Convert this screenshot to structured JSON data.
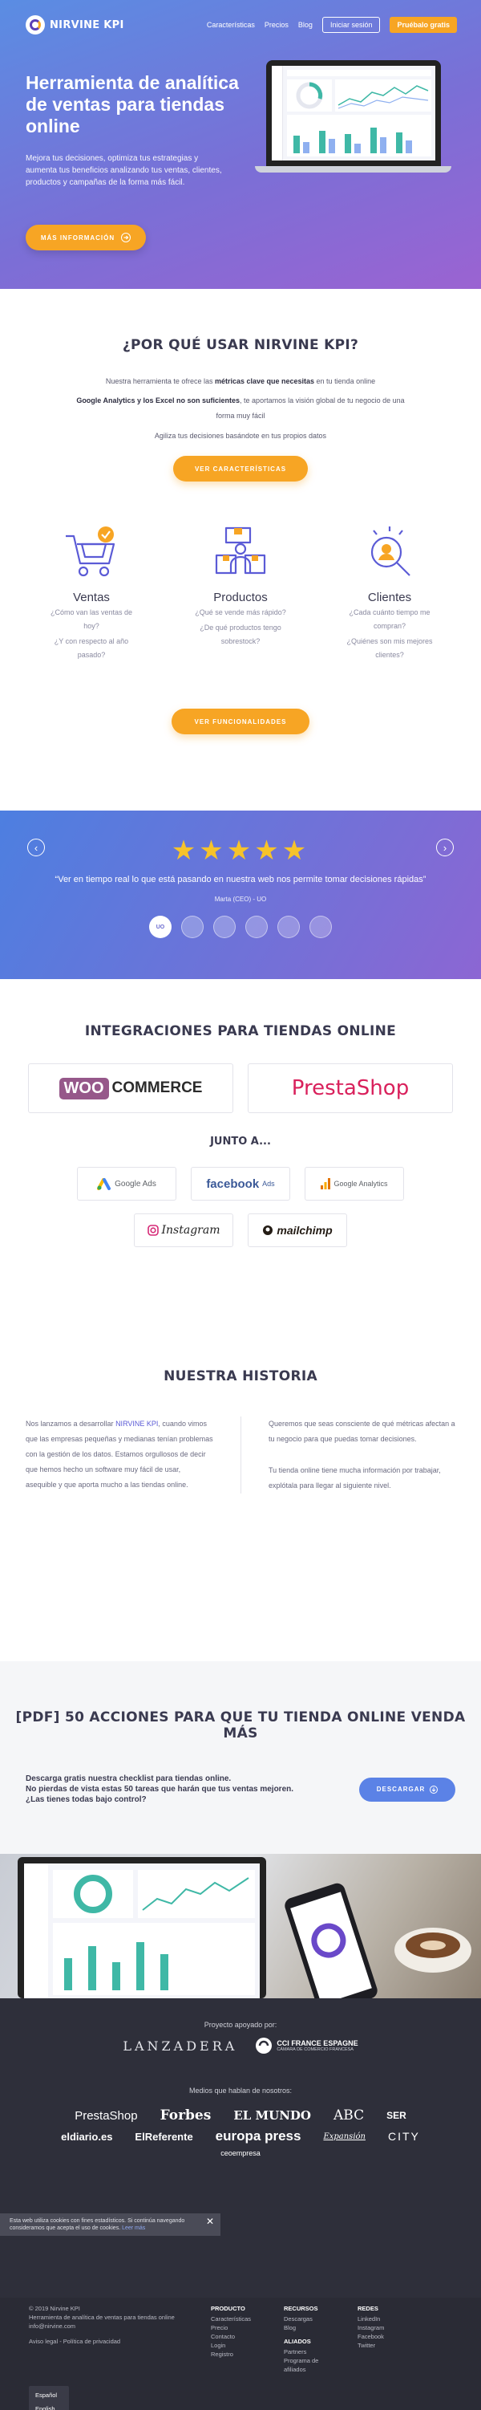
{
  "nav": {
    "brand": "NIRVINE KPI",
    "links": [
      "Características",
      "Precios",
      "Blog"
    ],
    "login": "Iniciar sesión",
    "trial": "Pruébalo gratis"
  },
  "hero": {
    "title": "Herramienta de analítica de ventas para tiendas online",
    "subtitle": "Mejora tus decisiones, optimiza tus estrategias y aumenta tus beneficios analizando tus ventas, clientes, productos y campañas de la forma más fácil.",
    "cta": "MÁS INFORMACIÓN"
  },
  "why": {
    "title": "¿POR QUÉ USAR NIRVINE KPI?",
    "p1_a": "Nuestra herramienta te ofrece las ",
    "p1_b": "métricas clave que necesitas",
    "p1_c": " en tu tienda online",
    "p2_a": "Google Analytics y los Excel no son suficientes",
    "p2_b": ", te aportamos la visión global de tu negocio de una forma muy fácil",
    "p3": "Agiliza tus decisiones basándote en tus propios datos",
    "btn1": "VER CARACTERÍSTICAS",
    "cols": [
      {
        "title": "Ventas",
        "q1": "¿Cómo van las ventas de hoy?",
        "q2": "¿Y con respecto al año pasado?"
      },
      {
        "title": "Productos",
        "q1": "¿Qué se vende más rápido?",
        "q2": "¿De qué productos tengo sobrestock?"
      },
      {
        "title": "Clientes",
        "q1": "¿Cada cuánto tiempo me compran?",
        "q2": "¿Quiénes son mis mejores clientes?"
      }
    ],
    "btn2": "VER FUNCIONALIDADES"
  },
  "testimonial": {
    "stars": "★★★★★",
    "quote": "“Ver en tiempo real lo que está pasando en nuestra web nos permite tomar decisiones rápidas”",
    "author": "Marta (CEO) - UO",
    "dots": [
      "UO",
      "",
      "",
      "",
      "",
      ""
    ]
  },
  "integrations": {
    "title": "INTEGRACIONES PARA TIENDAS ONLINE",
    "woo": "WOO",
    "commerce": "COMMERCE",
    "presta": "PrestaShop",
    "junto": "JUNTO A...",
    "google_ads": "Google Ads",
    "facebook": "facebook",
    "facebook_ads": "Ads",
    "google_analytics": "Google Analytics",
    "instagram": "Instagram",
    "mailchimp": "mailchimp"
  },
  "history": {
    "title": "NUESTRA HISTORIA",
    "left_a": "Nos lanzamos a desarrollar ",
    "left_b": "NIRVINE KPI",
    "left_c": ", cuando vimos que las empresas pequeñas y medianas tenían problemas con la gestión de los datos. Estamos orgullosos de decir que hemos hecho un software muy fácil de usar, asequible y que aporta mucho a las tiendas online.",
    "right_1": "Queremos que seas consciente de qué métricas afectan a tu negocio para que puedas tomar decisiones.",
    "right_2": "Tu tienda online tiene mucha información por trabajar, explótala para llegar al siguiente nivel."
  },
  "pdf": {
    "title": "[PDF] 50 ACCIONES PARA QUE TU TIENDA ONLINE VENDA MÁS",
    "l1": "Descarga gratis nuestra checklist para tiendas online.",
    "l2": "No pierdas de vista estas 50 tareas que harán que tus ventas mejoren.",
    "l3": "¿Las tienes todas bajo control?",
    "btn": "DESCARGAR"
  },
  "support": {
    "title": "Proyecto apoyado por:",
    "lanzadera": "LANZADERA",
    "cci_1": "CCI FRANCE ESPAGNE",
    "cci_2": "CÁMARA DE COMERCIO FRANCESA",
    "media_title": "Medios que hablan de nosotros:",
    "media": [
      "PrestaShop",
      "Forbes",
      "EL MUNDO",
      "ABC",
      "SER",
      "eldiario.es",
      "ElReferente",
      "europa press",
      "Expansión",
      "CITY",
      "ceoempresa"
    ]
  },
  "footer": {
    "copyright": "© 2019 Nirvine KPI",
    "tagline": "Herramienta de analítica de ventas para tiendas online",
    "email": "info@nirvine.com",
    "legal": "Aviso legal - Política de privacidad",
    "langs": [
      "Español",
      "English"
    ],
    "producto": {
      "title": "PRODUCTO",
      "items": [
        "Características",
        "Precio",
        "Contacto",
        "Login",
        "Registro"
      ]
    },
    "recursos": {
      "title": "RECURSOS",
      "items": [
        "Descargas",
        "Blog"
      ]
    },
    "aliados": {
      "title": "ALIADOS",
      "items": [
        "Partners",
        "Programa de afiliados"
      ]
    },
    "redes": {
      "title": "REDES",
      "items": [
        "LinkedIn",
        "Instagram",
        "Facebook",
        "Twitter"
      ]
    }
  },
  "cookie": {
    "text": "Esta web utiliza cookies con fines estadísticos. Si continúa navegando consideramos que acepta el uso de cookies.",
    "link": "Leer más",
    "close": "✕"
  },
  "colors": {
    "accent": "#f7a524",
    "brand": "#5b5bd6",
    "blue": "#5b82e6"
  },
  "icons": [
    "sales-cart-icon",
    "products-boxes-icon",
    "clients-search-icon",
    "arrow-right-icon",
    "arrow-left-icon",
    "download-icon",
    "star-icon",
    "close-icon"
  ]
}
